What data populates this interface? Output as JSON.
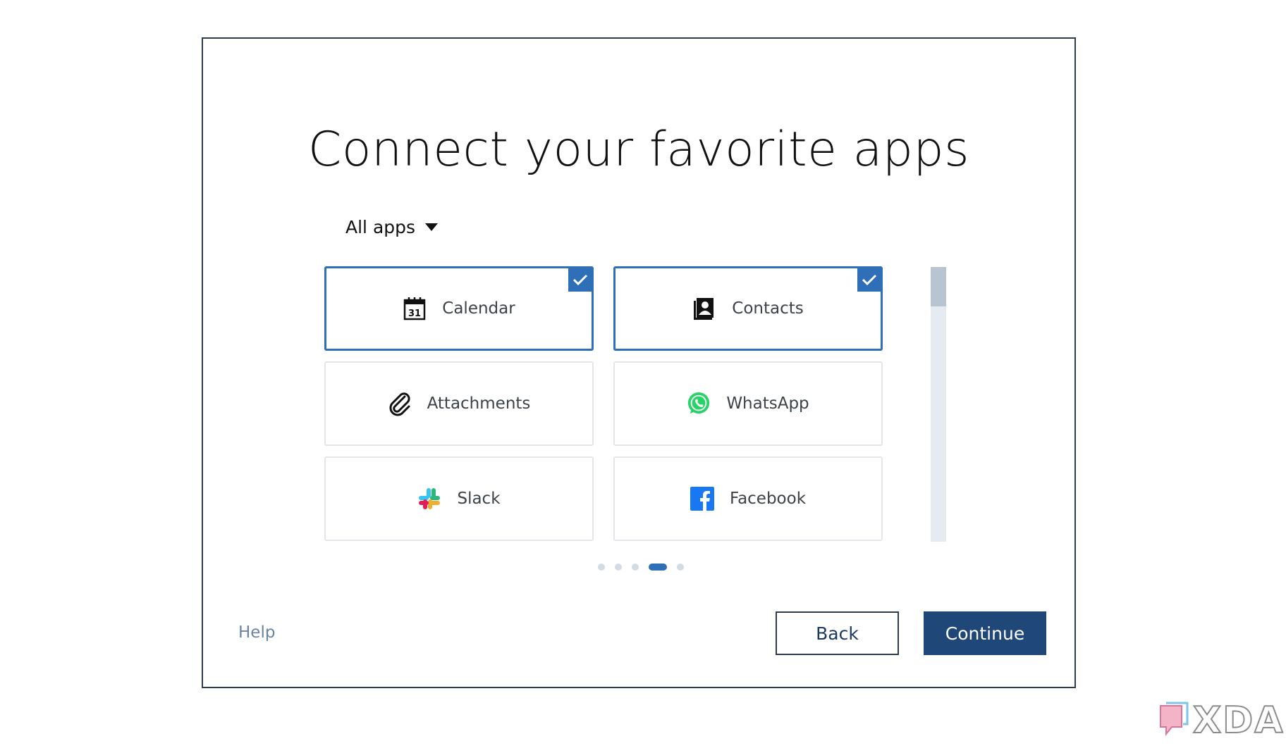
{
  "dialog": {
    "title": "Connect your favorite apps",
    "filter_label": "All apps",
    "apps": [
      {
        "label": "Calendar",
        "icon": "calendar-icon",
        "selected": true
      },
      {
        "label": "Contacts",
        "icon": "contacts-icon",
        "selected": true
      },
      {
        "label": "Attachments",
        "icon": "paperclip-icon",
        "selected": false
      },
      {
        "label": "WhatsApp",
        "icon": "whatsapp-icon",
        "selected": false
      },
      {
        "label": "Slack",
        "icon": "slack-icon",
        "selected": false
      },
      {
        "label": "Facebook",
        "icon": "facebook-icon",
        "selected": false
      }
    ],
    "calendar_day": "31",
    "pagination": {
      "pages": 5,
      "current": 4
    },
    "help_label": "Help",
    "back_label": "Back",
    "continue_label": "Continue"
  },
  "watermark": {
    "text": "XDA"
  },
  "colors": {
    "accent": "#2f6fb7",
    "primary_button": "#1f4777",
    "whatsapp": "#25d366",
    "facebook": "#1877f2"
  }
}
